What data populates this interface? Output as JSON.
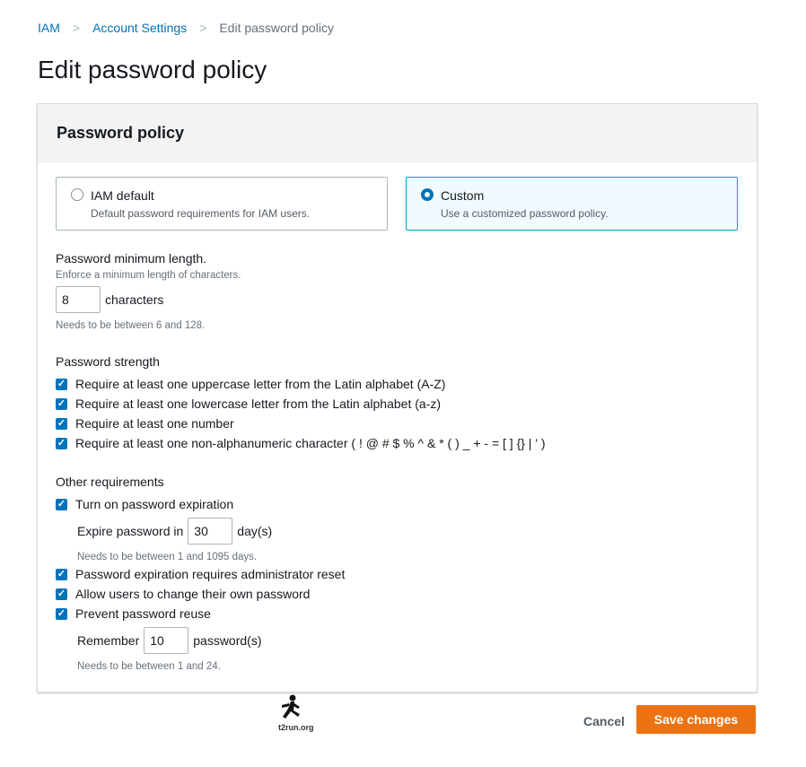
{
  "breadcrumb": [
    "IAM",
    "Account Settings",
    "Edit password policy"
  ],
  "page_title": "Edit password policy",
  "panel_title": "Password policy",
  "options": [
    {
      "title": "IAM default",
      "desc": "Default password requirements for IAM users.",
      "selected": false
    },
    {
      "title": "Custom",
      "desc": "Use a customized password policy.",
      "selected": true
    }
  ],
  "min_length": {
    "label": "Password minimum length.",
    "desc": "Enforce a minimum length of characters.",
    "value": "8",
    "unit": "characters",
    "hint": "Needs to be between 6 and 128."
  },
  "strength": {
    "label": "Password strength",
    "items": [
      "Require at least one uppercase letter from the Latin alphabet (A-Z)",
      "Require at least one lowercase letter from the Latin alphabet (a-z)",
      "Require at least one number",
      "Require at least one non-alphanumeric character ( ! @ # $ % ^ & * ( ) _ + - = [ ] {} | ' )"
    ]
  },
  "other": {
    "label": "Other requirements",
    "expiration": "Turn on password expiration",
    "expire_label": "Expire password in",
    "expire_value": "30",
    "expire_unit": "day(s)",
    "expire_hint": "Needs to be between 1 and 1095 days.",
    "admin_reset": "Password expiration requires administrator reset",
    "allow_change": "Allow users to change their own password",
    "prevent_reuse": "Prevent password reuse",
    "remember_label": "Remember",
    "remember_value": "10",
    "remember_unit": "password(s)",
    "remember_hint": "Needs to be between 1 and 24."
  },
  "footer": {
    "cancel": "Cancel",
    "save": "Save changes"
  },
  "watermark": "t2run.org",
  "accent": "#0073bb",
  "primary_button": "#ec7211"
}
